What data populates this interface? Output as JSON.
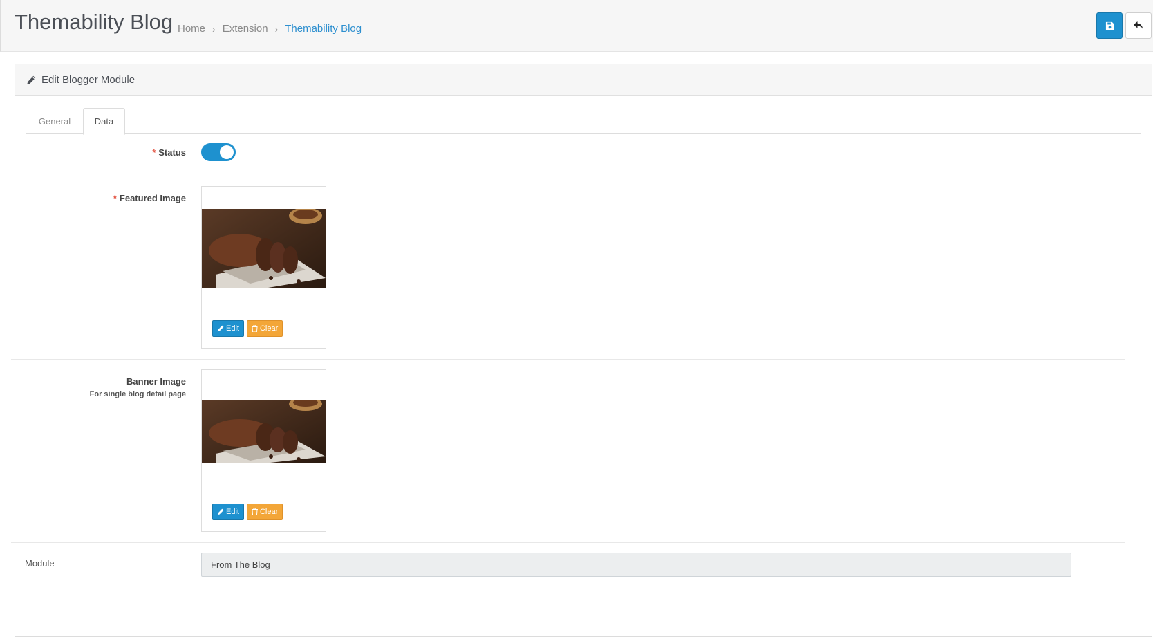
{
  "header": {
    "title": "Themability Blog",
    "breadcrumb": [
      "Home",
      "Extension",
      "Themability Blog"
    ],
    "save_icon": "floppy-disk-icon",
    "back_icon": "reply-arrow-icon"
  },
  "panel": {
    "icon": "pencil-icon",
    "title": "Edit Blogger Module"
  },
  "tabs": [
    {
      "label": "General",
      "active": false
    },
    {
      "label": "Data",
      "active": true
    }
  ],
  "form": {
    "status": {
      "label": "Status",
      "required": true,
      "enabled": true
    },
    "featured_image": {
      "label": "Featured Image",
      "required": true,
      "image_alt": "chocolate loaf cake slices on cloth",
      "edit_label": "Edit",
      "clear_label": "Clear"
    },
    "banner_image": {
      "label": "Banner Image",
      "help": "For single blog detail page",
      "image_alt": "chocolate loaf cake slices on cloth",
      "edit_label": "Edit",
      "clear_label": "Clear"
    },
    "module": {
      "label": "Module",
      "value": "From The Blog"
    }
  },
  "colors": {
    "primary": "#1e91cf",
    "warning": "#f3a638",
    "required": "#e3503e",
    "breadcrumb_active": "#2d8fcf"
  }
}
